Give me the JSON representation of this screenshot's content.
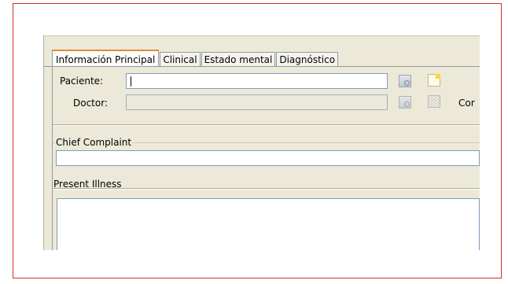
{
  "tabs": [
    {
      "label": "Información Principal",
      "active": true
    },
    {
      "label": "Clinical",
      "active": false
    },
    {
      "label": "Estado mental",
      "active": false
    },
    {
      "label": "Diagnóstico",
      "active": false
    }
  ],
  "form": {
    "patient_label": "Paciente:",
    "patient_value": "",
    "doctor_label": "Doctor:",
    "doctor_value": "",
    "truncated_label": "Cor",
    "chief_complaint_title": "Chief Complaint",
    "chief_complaint_value": "",
    "present_illness_title": "Present Illness",
    "present_illness_value": ""
  },
  "icons": {
    "patient_search": "search-icon",
    "patient_new": "new-note-icon",
    "doctor_search": "search-icon",
    "doctor_grid": "grid-icon"
  }
}
